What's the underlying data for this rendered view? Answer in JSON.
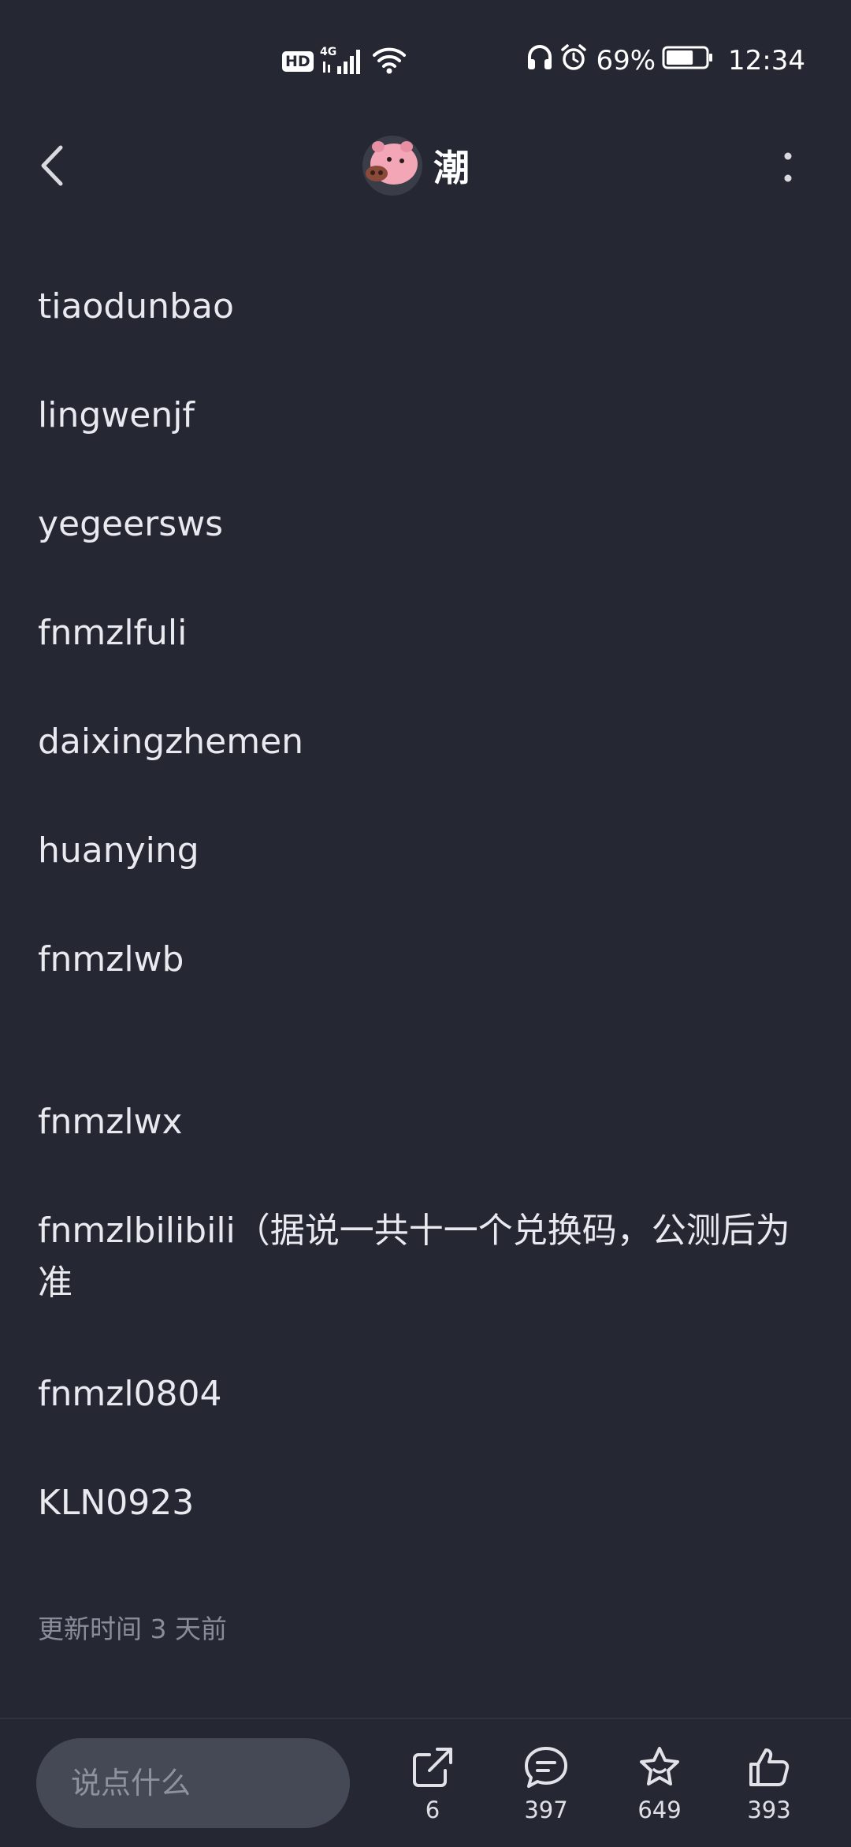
{
  "status_bar": {
    "hd_label": "HD",
    "network_label": "4G",
    "battery_percent_text": "69%",
    "battery_level": 0.69,
    "time": "12:34",
    "icons": [
      "signal-icon",
      "wifi-icon",
      "headphones-icon",
      "alarm-icon",
      "battery-icon"
    ]
  },
  "header": {
    "author_name": "潮",
    "icons": [
      "back-arrow-icon",
      "pig-avatar",
      "more-vertical-icon"
    ]
  },
  "content": {
    "lines": [
      "tiaodunbao",
      "lingwenjf",
      "yegeersws",
      "fnmzlfuli",
      "daixingzhemen",
      "huanying",
      "fnmzlwb",
      "fnmzlwx",
      "fnmzlbilibili（据说一共十一个兑换码，公测后为准",
      "fnmzl0804",
      "KLN0923"
    ],
    "update_time": "更新时间 3 天前"
  },
  "bottom_bar": {
    "comment_placeholder": "说点什么",
    "actions": [
      {
        "name": "share",
        "icon": "share-icon",
        "count": "6"
      },
      {
        "name": "comment",
        "icon": "comment-icon",
        "count": "397"
      },
      {
        "name": "favorite",
        "icon": "star-icon",
        "count": "649"
      },
      {
        "name": "like",
        "icon": "thumbs-up-icon",
        "count": "393"
      }
    ]
  },
  "colors": {
    "background": "#252733",
    "text": "#e9eaef",
    "muted_text": "#8a8d99",
    "input_background": "#454956"
  }
}
